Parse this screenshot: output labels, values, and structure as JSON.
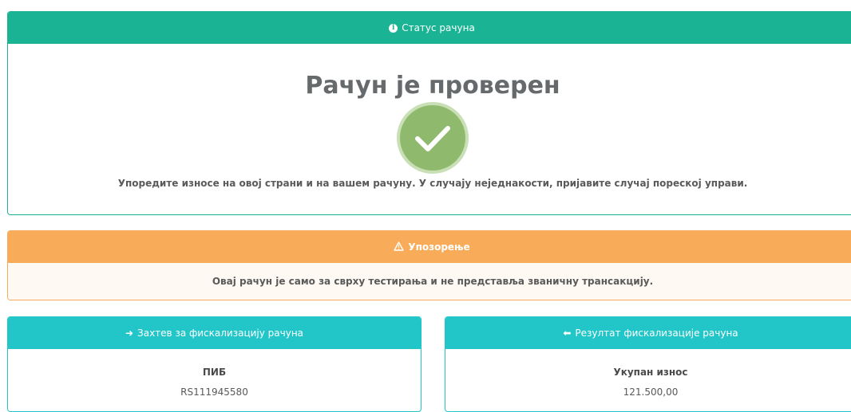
{
  "colors": {
    "primary": "#1ab394",
    "warning": "#f8ac59",
    "info": "#23c6c8",
    "check": "#8fba6e"
  },
  "status": {
    "header_icon": "info-circle-icon",
    "header_label": "Статус рачуна",
    "title": "Рачун је проверен",
    "check_icon": "checkmark-icon",
    "note": "Упоредите износе на овој страни и на вашем рачуну. У случају неједнакости, пријавите случај пореској управи."
  },
  "warning": {
    "header_icon": "warning-triangle-icon",
    "header_label": "Упозорење",
    "message": "Овај рачун је само за сврху тестирања и не представља званичну трансакцију."
  },
  "request": {
    "header_icon": "arrow-right-icon",
    "header_label": "Захтев за фискализацију рачуна",
    "field_label": "ПИБ",
    "field_value": "RS111945580"
  },
  "result": {
    "header_icon": "arrow-left-icon",
    "header_label": "Резултат фискализације рачуна",
    "field_label": "Укупан износ",
    "field_value": "121.500,00"
  }
}
